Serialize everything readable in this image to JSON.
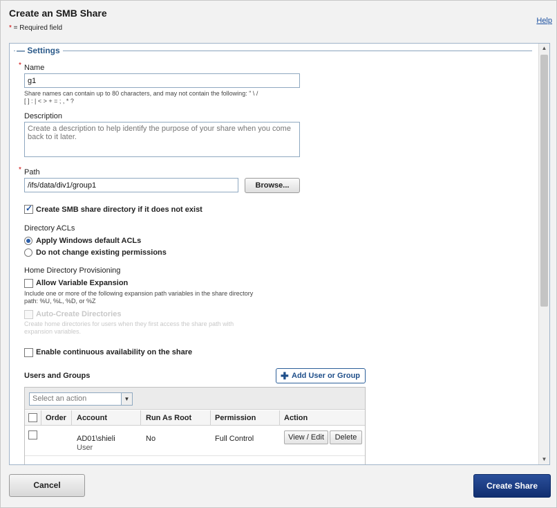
{
  "dialog": {
    "title": "Create an SMB Share",
    "required_star": "*",
    "required_note": " = Required field",
    "help": "Help"
  },
  "settings": {
    "legend_marker": "—",
    "legend": "Settings",
    "name": {
      "star": "*",
      "label": "Name",
      "value": "g1",
      "hint_line1": "Share names can contain up to 80 characters, and may not contain the following: \" \\ /",
      "hint_line2": "[ ] : | < > + = ; , * ?"
    },
    "description": {
      "label": "Description",
      "placeholder": "Create a description to help identify the purpose of your share when you come back to it later."
    },
    "path": {
      "star": "*",
      "label": "Path",
      "value": "/ifs/data/div1/group1",
      "browse": "Browse..."
    },
    "create_dir": {
      "label": "Create SMB share directory if it does not exist",
      "checked": true
    },
    "acls": {
      "heading": "Directory ACLs",
      "options": [
        {
          "label": "Apply Windows default ACLs",
          "selected": true
        },
        {
          "label": "Do not change existing permissions",
          "selected": false
        }
      ]
    },
    "home_dir": {
      "heading": "Home Directory Provisioning",
      "variable_expansion": {
        "label": "Allow Variable Expansion",
        "checked": false
      },
      "variable_hint_line1": "Include one or more of the following expansion path variables in the share directory",
      "variable_hint_line2": "path: %U, %L, %D, or %Z",
      "auto_create": {
        "label": "Auto-Create Directories",
        "checked": false,
        "enabled": false
      },
      "auto_hint_line1": "Create home directories for users when they first access the share path with",
      "auto_hint_line2": "expansion variables."
    },
    "continuous": {
      "label": "Enable continuous availability on the share",
      "checked": false
    },
    "users_groups": {
      "heading": "Users and Groups",
      "add_plus": "✚",
      "add_button": "Add User or Group",
      "select_placeholder": "Select an action",
      "select_arrow": "▼",
      "columns": [
        "Order",
        "Account",
        "Run As Root",
        "Permission",
        "Action"
      ],
      "rows": [
        {
          "order": "",
          "account": "AD01\\shieli",
          "account_type": "User",
          "run_as_root": "No",
          "permission": "Full Control",
          "view_edit": "View / Edit",
          "delete": "Delete"
        }
      ]
    }
  },
  "scrollbar": {
    "up": "▲",
    "down": "▼"
  },
  "footer": {
    "cancel": "Cancel",
    "create": "Create Share"
  },
  "colors": {
    "primary": "#1a3a80",
    "link": "#1a4fa0",
    "required": "#cc0000",
    "legend": "#2b5a8a"
  }
}
